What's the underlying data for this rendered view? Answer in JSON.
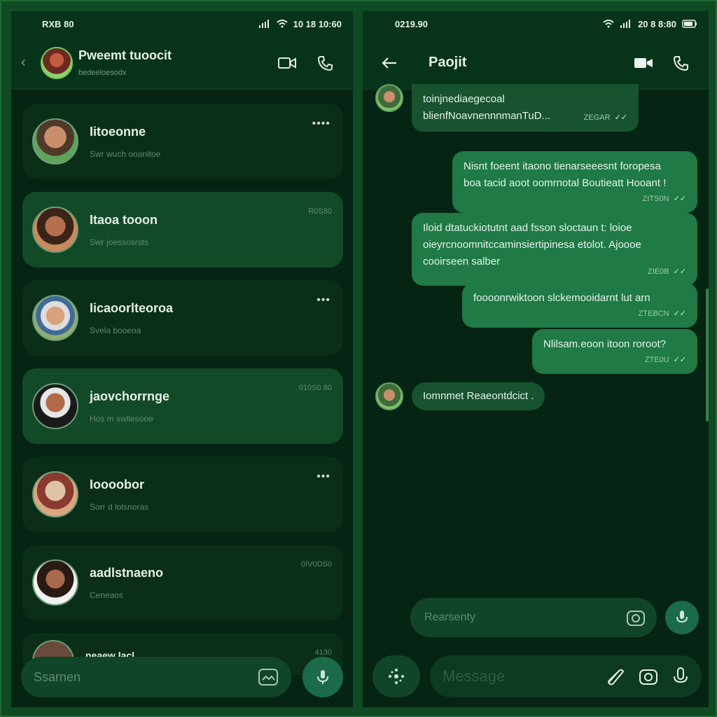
{
  "left": {
    "status": {
      "time": "RXB 80",
      "right": "10 18 10:60"
    },
    "header": {
      "title": "Pweemt tuoocit",
      "subtitle": "bedeeloesodx"
    },
    "chats": [
      {
        "name": "Iitoeonne",
        "preview": "Swr wuch ooanitoe",
        "time": "",
        "dots": "••••"
      },
      {
        "name": "Itaoa tooon",
        "preview": "Swr joessosrsts",
        "time": "R0S80",
        "dots": ""
      },
      {
        "name": "Iicaoorlteoroa",
        "preview": "Svela booeoa",
        "time": "",
        "dots": "•••"
      },
      {
        "name": "jaovchorrnge",
        "preview": "Hos m swllesooe",
        "time": "010S0 80",
        "dots": ""
      },
      {
        "name": "Ioooobor",
        "preview": "Sorr d lolsnoras",
        "time": "",
        "dots": "•••"
      },
      {
        "name": "aadlstnaeno",
        "preview": "Ceneaos",
        "time": "0IV0DS0",
        "dots": ""
      },
      {
        "name": "neaew lacl",
        "preview": "",
        "time": "4130",
        "dots": ""
      }
    ],
    "search_placeholder": "Ssarnen"
  },
  "right": {
    "status": {
      "time": "0219.90",
      "right": "20 8 8:80"
    },
    "header": {
      "title": "Paojit"
    },
    "messages": [
      {
        "dir": "in",
        "lines": [
          "toinjnediaegecoal",
          "blienfNoavnennnmanTuD..."
        ],
        "meta": "ZEGAR"
      },
      {
        "dir": "out",
        "lines": [
          "Nisnt foeent itaono tienarseeesnt foropesa",
          "boa tacid aoot oomrnotal Boutieatt Hooant !"
        ],
        "meta": "ZITS0N"
      },
      {
        "dir": "out",
        "lines": [
          "Iloid dtatuckiotutnt aad fsson sloctaun t: loioe",
          "oieyrcnoomnitccaminsiertipinesa etolot. Ajoooe",
          "cooirseen salber"
        ],
        "meta": "ZIE0B"
      },
      {
        "dir": "out",
        "lines": [
          "foooonrwiktoon slckemooidarnt lut arn"
        ],
        "meta": "ZTEBCN"
      },
      {
        "dir": "out",
        "lines": [
          "Nlilsam.eoon itoon roroot?"
        ],
        "meta": "ZTE0U"
      },
      {
        "dir": "in",
        "lines": [
          "Iomnmet Reaeontdcict ."
        ],
        "meta": ""
      }
    ],
    "reply_placeholder": "Rearsenty",
    "message_placeholder": "Message"
  },
  "colors": {
    "accent": "#1f7a45",
    "background": "#062413",
    "frame": "#0f4a24"
  }
}
